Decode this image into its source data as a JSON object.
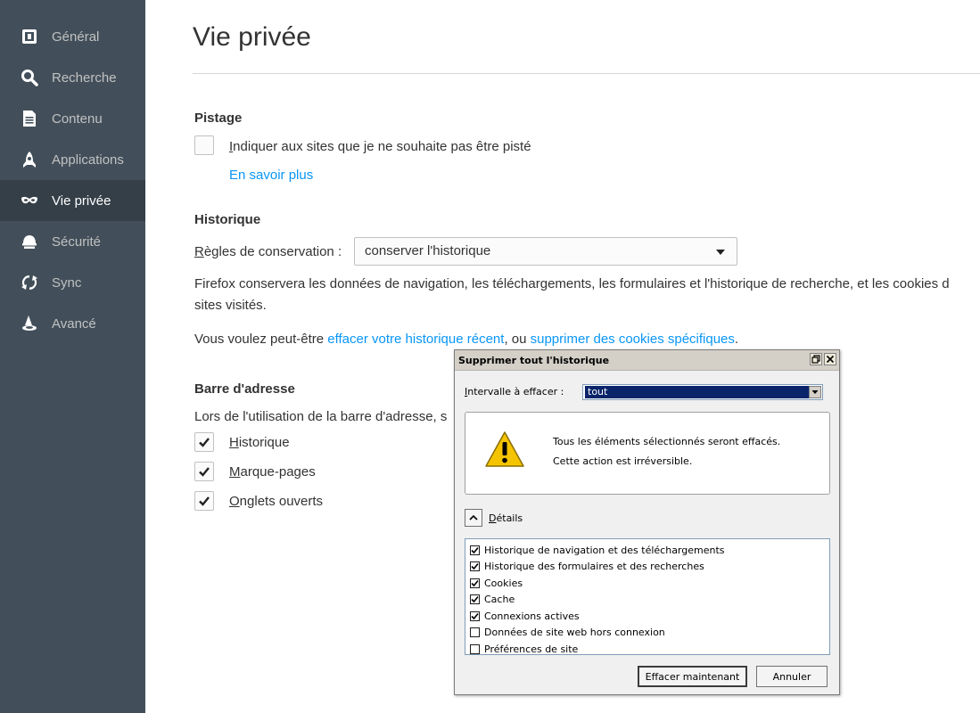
{
  "sidebar": {
    "items": [
      {
        "label": "Général",
        "icon": "general-icon"
      },
      {
        "label": "Recherche",
        "icon": "search-icon"
      },
      {
        "label": "Contenu",
        "icon": "document-icon"
      },
      {
        "label": "Applications",
        "icon": "rocket-icon"
      },
      {
        "label": "Vie privée",
        "icon": "mask-icon",
        "active": true
      },
      {
        "label": "Sécurité",
        "icon": "helmet-icon"
      },
      {
        "label": "Sync",
        "icon": "sync-icon"
      },
      {
        "label": "Avancé",
        "icon": "wizard-hat-icon"
      }
    ]
  },
  "page": {
    "title": "Vie privée"
  },
  "tracking": {
    "heading": "Pistage",
    "dnt_label": "Indiquer aux sites que je ne souhaite pas être pisté",
    "dnt_checked": false,
    "learn_more": "En savoir plus"
  },
  "history": {
    "heading": "Historique",
    "rules_label": "Règles de conservation :",
    "rules_value": "conserver l'historique",
    "description_line1": "Firefox conservera les données de navigation, les téléchargements, les formulaires et l'historique de recherche, et les cookies d",
    "description_line2": "sites visités.",
    "maybe_prefix": "Vous voulez peut-être ",
    "clear_recent_link": "effacer votre historique récent",
    "or_text": ", ou ",
    "remove_cookies_link": "supprimer des cookies spécifiques",
    "end_dot": "."
  },
  "address_bar": {
    "heading": "Barre d'adresse",
    "intro": "Lors de l'utilisation de la barre d'adresse, s",
    "options": [
      {
        "label": "Historique",
        "checked": true
      },
      {
        "label": "Marque-pages",
        "checked": true
      },
      {
        "label": "Onglets ouverts",
        "checked": true
      }
    ]
  },
  "dialog": {
    "title": "Supprimer tout l'historique",
    "range_label": "Intervalle à effacer :",
    "range_value": "tout",
    "warning_line1": "Tous les éléments sélectionnés seront effacés.",
    "warning_line2": "Cette action est irréversible.",
    "details_label": "Détails",
    "items": [
      {
        "label": "Historique de navigation et des téléchargements",
        "checked": true
      },
      {
        "label": "Historique des formulaires et des recherches",
        "checked": true
      },
      {
        "label": "Cookies",
        "checked": true
      },
      {
        "label": "Cache",
        "checked": true
      },
      {
        "label": "Connexions actives",
        "checked": true
      },
      {
        "label": "Données de site web hors connexion",
        "checked": false
      },
      {
        "label": "Préférences de site",
        "checked": false
      }
    ],
    "clear_now_label": "Effacer maintenant",
    "cancel_label": "Annuler"
  },
  "colors": {
    "sidebar_bg": "#424f5a",
    "sidebar_active_bg": "#343f48",
    "link": "#0996f8",
    "selection": "#0a246a",
    "warning": "#f5c400"
  }
}
